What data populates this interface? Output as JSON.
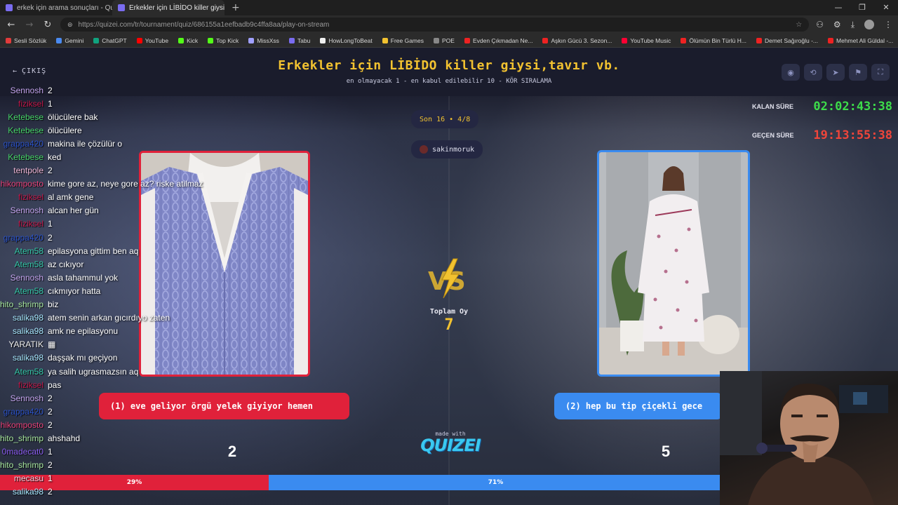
{
  "browser": {
    "tabs": [
      {
        "title": "erkek için arama sonuçları - Quizei",
        "active": false
      },
      {
        "title": "Erkekler için LİBİDO killer giysi,tav",
        "active": true
      }
    ],
    "url": "https://quizei.com/tr/tournament/quiz/686155a1eefbadb9c4ffa8aa/play-on-stream",
    "bookmarks": [
      "Sesli Sözlük",
      "Gemini",
      "ChatGPT",
      "YouTube",
      "Kick",
      "Top Kick",
      "MissXss",
      "Tabu",
      "HowLongToBeat",
      "Free Games",
      "POE",
      "Evden Çıkmadan Ne...",
      "Aşkın Gücü 3. Sezon...",
      "YouTube Music",
      "Ölümün Bin Türlü H...",
      "Demet Sağıroğlu -...",
      "Mehmet Ali Güldal -..."
    ]
  },
  "header": {
    "exit_label": "ÇIKIŞ",
    "title": "Erkekler için LİBİDO killer giysi,tavır vb.",
    "subtitle": "en olmayacak 1 - en kabul edilebilir 10 - KÖR SIRALAMA",
    "icons": [
      "eye-icon",
      "rotate-icon",
      "send-icon",
      "flag-icon",
      "fullscreen-icon"
    ]
  },
  "timers": {
    "remaining_label": "KALAN SÜRE",
    "remaining_value": "02:02:43:38",
    "remaining_color": "#3ddc4a",
    "elapsed_label": "GEÇEN SÜRE",
    "elapsed_value": "19:13:55:38",
    "elapsed_color": "#f0453a"
  },
  "round": {
    "label": "Son 16 • 4/8",
    "user": "sakinmoruk"
  },
  "votes": {
    "total_label": "Toplam Oy",
    "total_value": "7"
  },
  "choices": {
    "left": {
      "label": "(1) eve geliyor örgü yelek giyiyor hemen",
      "count": "2",
      "percent_label": "29%",
      "percent": 29,
      "color": "#e0213a"
    },
    "right": {
      "label": "(2) hep bu tip çiçekli gece",
      "count": "5",
      "percent_label": "71%",
      "percent": 71,
      "color": "#3a8bf0"
    }
  },
  "footer": {
    "made_with": "made with",
    "logo": "QUIZEI"
  },
  "chat": [
    {
      "name": "Sennosh",
      "color": "#c6a6f0",
      "msg": "2"
    },
    {
      "name": "fiziksel",
      "color": "#c2184a",
      "msg": "1"
    },
    {
      "name": "Ketebese",
      "color": "#48d46a",
      "msg": "ölücülere bak"
    },
    {
      "name": "Ketebese",
      "color": "#48d46a",
      "msg": "ölücülere"
    },
    {
      "name": "grappa420",
      "color": "#2b52c8",
      "msg": "makina ile çözülür o"
    },
    {
      "name": "Ketebese",
      "color": "#48d46a",
      "msg": "ked"
    },
    {
      "name": "tentpole",
      "color": "#f0b8d8",
      "msg": "2"
    },
    {
      "name": "hikomposto",
      "color": "#e8427a",
      "msg": "kime gore az, neye gore az? riske atilmaz"
    },
    {
      "name": "fiziksel",
      "color": "#c2184a",
      "msg": "al amk gene"
    },
    {
      "name": "Sennosh",
      "color": "#c6a6f0",
      "msg": "alcan her gün"
    },
    {
      "name": "fiziksel",
      "color": "#c2184a",
      "msg": "1"
    },
    {
      "name": "grappa420",
      "color": "#2b52c8",
      "msg": "2"
    },
    {
      "name": "Atem58",
      "color": "#34c8a8",
      "msg": "epilasyona gittim ben aq"
    },
    {
      "name": "Atem58",
      "color": "#34c8a8",
      "msg": "az cıkıyor"
    },
    {
      "name": "Sennosh",
      "color": "#c6a6f0",
      "msg": "asla tahammul yok"
    },
    {
      "name": "Atem58",
      "color": "#34c8a8",
      "msg": "cıkmıyor hatta"
    },
    {
      "name": "chito_shrimp",
      "color": "#a8e8a0",
      "msg": "biz"
    },
    {
      "name": "salika98",
      "color": "#a8e8ff",
      "msg": "atem senin arkan gıcırdıyo zaten"
    },
    {
      "name": "salika98",
      "color": "#a8e8ff",
      "msg": "amk ne epilasyonu"
    },
    {
      "name": "YARATIK",
      "color": "#f0f0f0",
      "msg": "▦"
    },
    {
      "name": "salika98",
      "color": "#a8e8ff",
      "msg": "daşşak mı geçiyon"
    },
    {
      "name": "Atem58",
      "color": "#34c8a8",
      "msg": "ya salih ugrasmazsın aq"
    },
    {
      "name": "fiziksel",
      "color": "#c2184a",
      "msg": "pas"
    },
    {
      "name": "Sennosh",
      "color": "#c6a6f0",
      "msg": "2"
    },
    {
      "name": "grappa420",
      "color": "#2b52c8",
      "msg": "2"
    },
    {
      "name": "hikomposto",
      "color": "#e8427a",
      "msg": "2"
    },
    {
      "name": "chito_shrimp",
      "color": "#a8e8a0",
      "msg": "ahshahd"
    },
    {
      "name": "0madecat0",
      "color": "#8a5cf0",
      "msg": "1"
    },
    {
      "name": "chito_shrimp",
      "color": "#a8e8a0",
      "msg": "2"
    },
    {
      "name": "mecasu",
      "color": "#f4d0e0",
      "msg": "1"
    },
    {
      "name": "salika98",
      "color": "#a8e8ff",
      "msg": "2"
    }
  ]
}
